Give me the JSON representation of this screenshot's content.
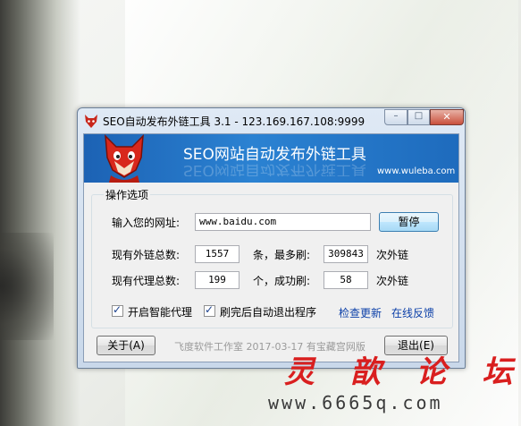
{
  "window": {
    "title": "SEO自动发布外链工具 3.1 - 123.169.167.108:9999",
    "controls": {
      "minimize": "–",
      "maximize": "□",
      "close": "✕"
    }
  },
  "banner": {
    "title": "SEO网站自动发布外链工具",
    "url": "www.wuleba.com",
    "mascot_icon": "red-fox-mascot"
  },
  "options": {
    "group_label": "操作选项",
    "url_label": "输入您的网址:",
    "url_value": "www.baidu.com",
    "pause_button": "暂停",
    "links_label": "现有外链总数:",
    "links_value": "1557",
    "links_unit": "条，最多刷:",
    "max_brush_value": "309843",
    "times_unit_1": "次外链",
    "proxy_label": "现有代理总数:",
    "proxy_value": "199",
    "proxy_unit": "个，成功刷:",
    "success_value": "58",
    "times_unit_2": "次外链",
    "smart_proxy_label": "开启智能代理",
    "smart_proxy_checked": true,
    "auto_exit_label": "刷完后自动退出程序",
    "auto_exit_checked": true,
    "check_update_link": "检查更新",
    "feedback_link": "在线反馈"
  },
  "footer": {
    "about_button": "关于(A)",
    "studio_text": "飞度软件工作室  2017-03-17  有宝藏宫网版",
    "exit_button": "退出(E)"
  },
  "watermark": {
    "brand": "灵  歆  论  坛",
    "url": "www.6665q.com"
  },
  "colors": {
    "banner": "#2b82d2",
    "link": "#0b3fa8",
    "watermark": "#d91f1f"
  }
}
